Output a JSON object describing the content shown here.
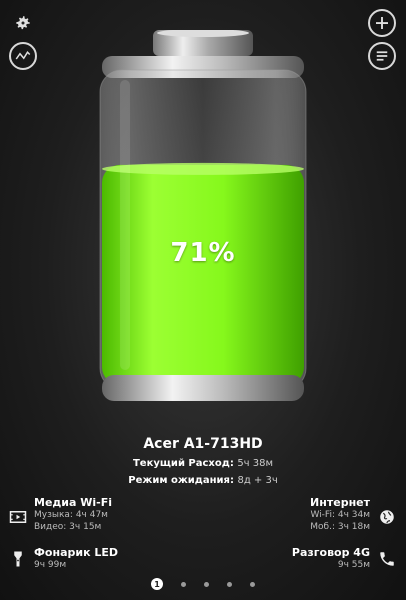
{
  "battery": {
    "percent_label": "71%",
    "level": 0.71,
    "fill_color": "#88ff22"
  },
  "device": {
    "name": "Acer A1-713HD",
    "current_label": "Текущий Расход:",
    "current_value": "5ч 38м",
    "standby_label": "Режим ожидания:",
    "standby_value": "8д + 3ч"
  },
  "left_blocks": [
    {
      "title": "Медиа Wi-Fi",
      "lines": [
        "Музыка: 4ч 47м",
        "Видео: 3ч 15м"
      ],
      "icon": "video-icon"
    },
    {
      "title": "Фонарик LED",
      "lines": [
        "9ч 99м"
      ],
      "icon": "flashlight-icon"
    }
  ],
  "right_blocks": [
    {
      "title": "Интернет",
      "lines": [
        "Wi-Fi: 4ч 34м",
        "Моб.: 3ч 18м"
      ],
      "icon": "globe-icon"
    },
    {
      "title": "Разговор 4G",
      "lines": [
        "9ч 55м"
      ],
      "icon": "phone-icon"
    }
  ],
  "pager": {
    "active": "1",
    "count": 5
  },
  "toolbar_icons": [
    "gear-icon",
    "graph-icon",
    "plus-icon",
    "menu-icon"
  ]
}
